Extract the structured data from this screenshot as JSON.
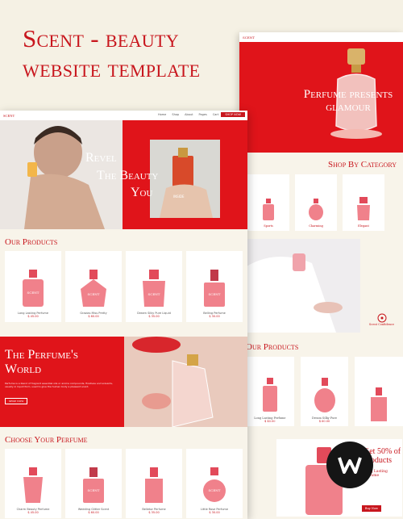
{
  "headline": "Scent - beauty website template",
  "main": {
    "nav": {
      "logo": "SCENT",
      "links": [
        "Home",
        "Shop",
        "About",
        "Pages",
        "Cart"
      ],
      "button": "SHOP NOW"
    },
    "hero": {
      "line1": "Revel",
      "line2": "The Beauty",
      "line3": "You",
      "inside": "INSIDE"
    },
    "products": {
      "title": "Our Products",
      "items": [
        {
          "name": "Long Lasting Perfume",
          "price": "$ 45.00"
        },
        {
          "name": "Grazias Miss Pretty",
          "price": "$ 60.00"
        },
        {
          "name": "Dream Silky Pure Liquid",
          "price": "$ 35.00"
        },
        {
          "name": "Belling Perfume",
          "price": "$ 30.00"
        }
      ]
    },
    "world": {
      "title_line1": "The Perfume's",
      "title_line2": "World",
      "body": "Perfume is a blend of fragrant essential oils or aroma compounds, fixatives and solvents, usually in liquid form, used to give the human body a pleasant scent.",
      "button": "SHOP NOW"
    },
    "choose": {
      "title": "Choose Your Perfume",
      "items": [
        {
          "name": "Charm Beauty Perfume",
          "price": "$ 45.00"
        },
        {
          "name": "Wedding Glitter Scent",
          "price": "$ 60.00"
        },
        {
          "name": "Belletor Perfume",
          "price": "$ 35.00"
        },
        {
          "name": "Little Rose Perfume",
          "price": "$ 30.00"
        }
      ]
    }
  },
  "side": {
    "logo": "SCENT",
    "hero_text": "Perfume presents glamour",
    "category_title": "Shop By Category",
    "categories": [
      "Sports",
      "Charming",
      "Elegant"
    ],
    "photo_caption": "Scent Confidence",
    "products_title": "Our Products",
    "products": [
      {
        "name": "Long Lasting Perfume",
        "price": "$ 45.00"
      },
      {
        "name": "Dream Silky Pure",
        "price": "$ 60.00"
      }
    ],
    "promo_title": "Get 50% of Products",
    "promo_sub": "Long Lasting Perfume",
    "promo_button": "Buy Now"
  },
  "colors": {
    "accent": "#c8161d",
    "hero_red": "#e0141a",
    "cream": "#f5f1e4",
    "bottle": "#f0818b"
  }
}
